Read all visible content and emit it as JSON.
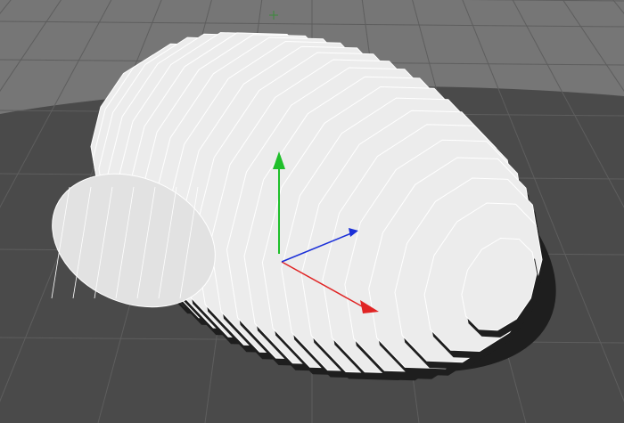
{
  "viewport": {
    "background_color": "#4a4a4a",
    "sky_color": "#767676",
    "grid_color": "#5e5e5e",
    "mesh_color": "#ececec",
    "mesh_shadow_color": "#1e1e1e",
    "edge_color": "#ffffff"
  },
  "scene_object": {
    "name": "sliced-ellipsoid-mesh",
    "selected": true
  },
  "gizmo": {
    "type": "move",
    "axes": [
      {
        "name": "y-axis",
        "color": "#1fbf2a"
      },
      {
        "name": "x-axis",
        "color": "#e02424"
      },
      {
        "name": "z-axis",
        "color": "#1a2fd8"
      }
    ]
  },
  "world_axis_indicator": {
    "color": "#3b8a3b"
  }
}
